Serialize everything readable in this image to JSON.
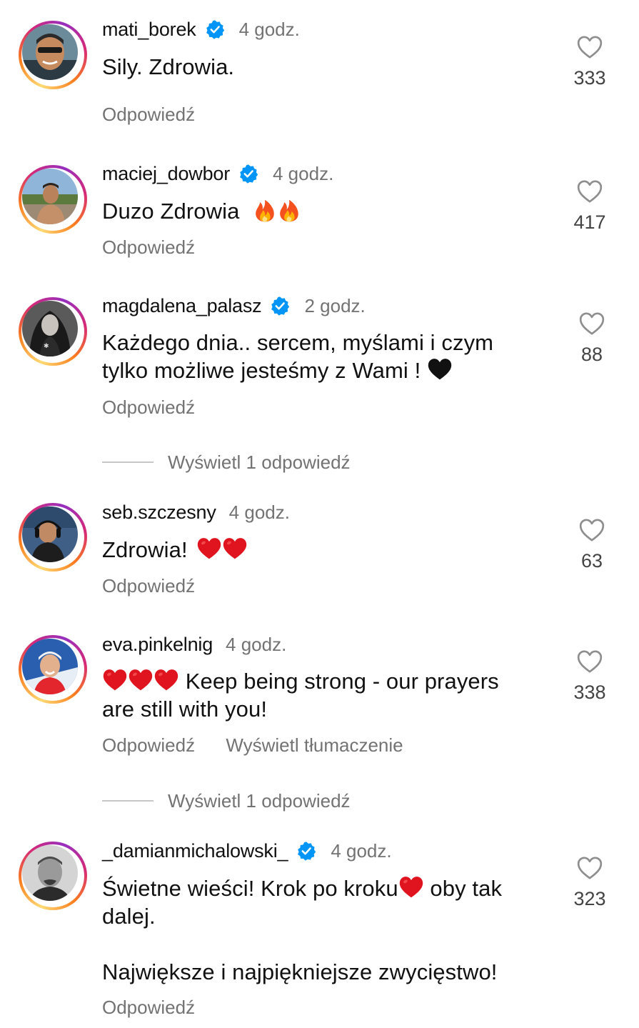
{
  "comments": [
    {
      "username": "mati_borek",
      "verified": true,
      "time": "4 godz.",
      "text": "Sily. Zdrowia.",
      "emoji": [],
      "likes": "333",
      "reply_label": "Odpowiedź"
    },
    {
      "username": "maciej_dowbor",
      "verified": true,
      "time": "4 godz.",
      "text": "Duzo Zdrowia",
      "emoji": [
        "fire",
        "fire"
      ],
      "likes": "417",
      "reply_label": "Odpowiedź"
    },
    {
      "username": "magdalena_palasz",
      "verified": true,
      "time": "2 godz.",
      "text_line1": "Każdego dnia.. sercem, myślami i czym",
      "text_line2": "tylko możliwe jesteśmy z Wami !",
      "emoji": [
        "black-heart"
      ],
      "likes": "88",
      "reply_label": "Odpowiedź",
      "view_replies": "Wyświetl 1 odpowiedź"
    },
    {
      "username": "seb.szczesny",
      "verified": false,
      "time": "4 godz.",
      "text": "Zdrowia!",
      "emoji": [
        "red-heart",
        "red-heart"
      ],
      "likes": "63",
      "reply_label": "Odpowiedź"
    },
    {
      "username": "eva.pinkelnig",
      "verified": false,
      "time": "4 godz.",
      "text_line1": "Keep being strong - our prayers",
      "text_line2": "are still with you!",
      "emoji": [
        "red-heart",
        "red-heart",
        "red-heart"
      ],
      "likes": "338",
      "reply_label": "Odpowiedź",
      "translate_label": "Wyświetl tłumaczenie",
      "view_replies": "Wyświetl 1 odpowiedź"
    },
    {
      "username": "_damianmichalowski_",
      "verified": true,
      "time": "4 godz.",
      "text_line1a": "Świetne wieści! Krok po kroku",
      "text_line1b": "oby tak",
      "text_line2": "dalej.",
      "text_line3": "Największe i najpiękniejsze zwycięstwo!",
      "emoji": [
        "red-heart"
      ],
      "likes": "323",
      "reply_label": "Odpowiedź"
    }
  ],
  "colors": {
    "text": "#111111",
    "secondary": "#737373",
    "verified": "#0095f6",
    "red_heart": "#e0141e",
    "ring_start": "#feda75",
    "ring_end": "#962fbf"
  },
  "icons": {
    "like": "heart-outline-icon",
    "verified": "verified-badge-icon"
  }
}
